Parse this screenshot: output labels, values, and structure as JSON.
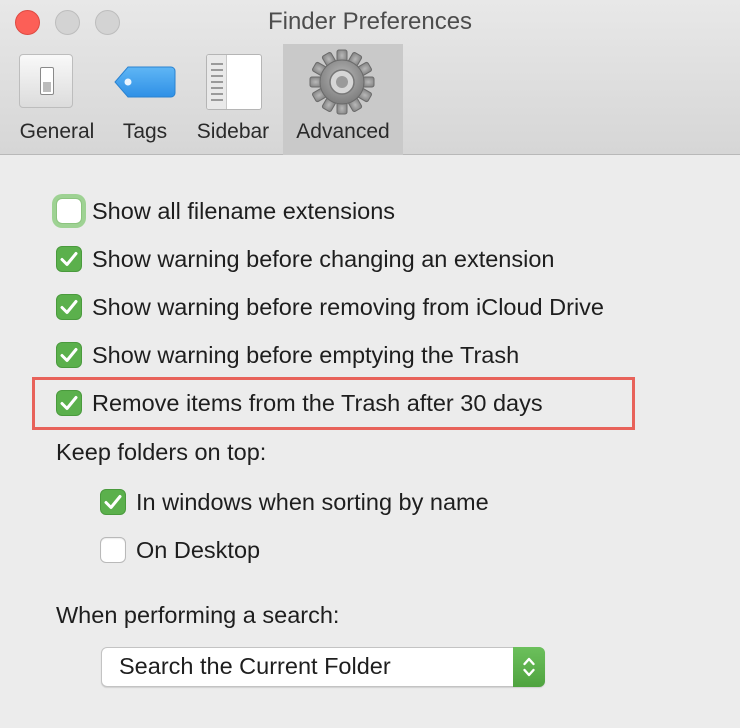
{
  "window": {
    "title": "Finder Preferences"
  },
  "tabs": [
    {
      "label": "General",
      "icon": "general-switch-icon",
      "selected": false
    },
    {
      "label": "Tags",
      "icon": "tag-icon",
      "selected": false
    },
    {
      "label": "Sidebar",
      "icon": "sidebar-icon",
      "selected": false
    },
    {
      "label": "Advanced",
      "icon": "gear-icon",
      "selected": true
    }
  ],
  "options": [
    {
      "label": "Show all filename extensions",
      "checked": false
    },
    {
      "label": "Show warning before changing an extension",
      "checked": true
    },
    {
      "label": "Show warning before removing from iCloud Drive",
      "checked": true
    },
    {
      "label": "Show warning before emptying the Trash",
      "checked": true
    },
    {
      "label": "Remove items from the Trash after 30 days",
      "checked": true,
      "highlighted": true
    }
  ],
  "keep_folders": {
    "heading": "Keep folders on top:",
    "options": [
      {
        "label": "In windows when sorting by name",
        "checked": true
      },
      {
        "label": "On Desktop",
        "checked": false
      }
    ]
  },
  "search": {
    "heading": "When performing a search:",
    "selected": "Search the Current Folder"
  },
  "colors": {
    "accent_green": "#5bb04c",
    "highlight_red": "#e8625a",
    "close_button": "#fc5f57"
  }
}
